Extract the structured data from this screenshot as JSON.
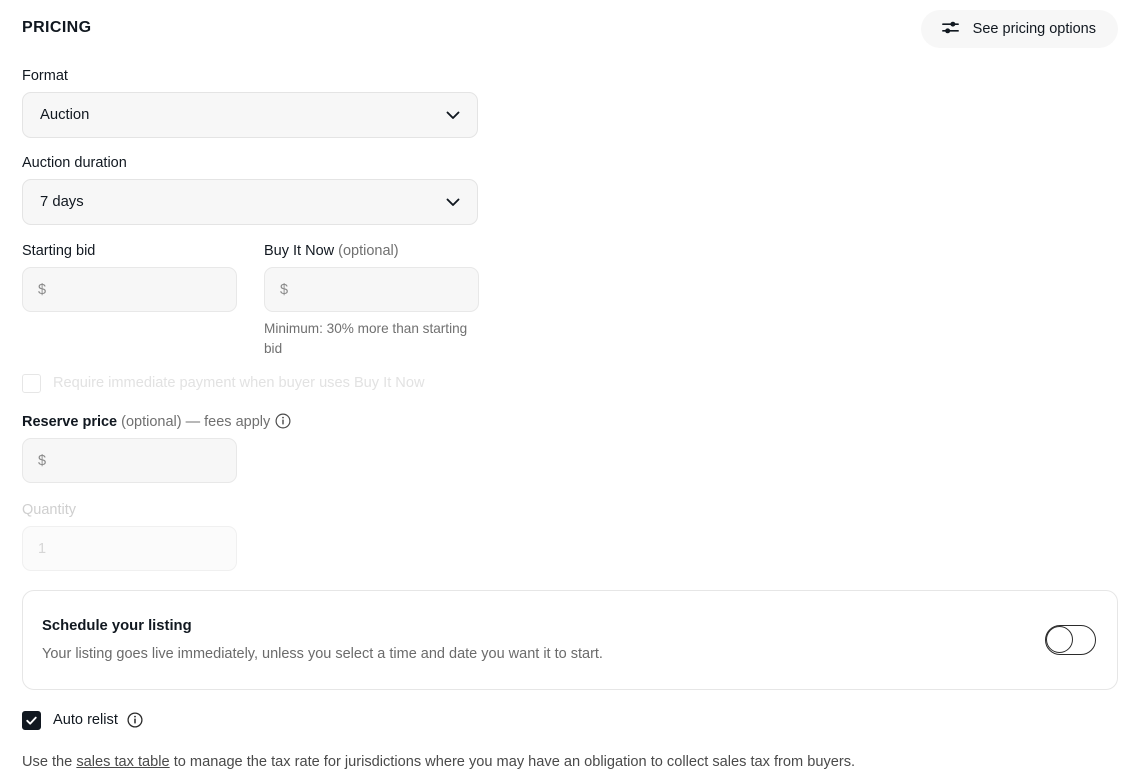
{
  "header": {
    "title": "PRICING",
    "pricing_options_button": "See pricing options",
    "pricing_options_icon": "sliders-icon"
  },
  "format": {
    "label": "Format",
    "value": "Auction",
    "chevron_icon": "chevron-down-icon"
  },
  "auction_duration": {
    "label": "Auction duration",
    "value": "7 days",
    "chevron_icon": "chevron-down-icon"
  },
  "starting_bid": {
    "label": "Starting bid",
    "placeholder": "$",
    "value": ""
  },
  "buy_it_now": {
    "label": "Buy It Now",
    "label_optional": "(optional)",
    "placeholder": "$",
    "value": "",
    "helper": "Minimum: 30% more than starting bid"
  },
  "require_immediate_payment": {
    "label": "Require immediate payment when buyer uses Buy It Now",
    "checked": false,
    "disabled": true
  },
  "reserve_price": {
    "label": "Reserve price",
    "label_suffix": "(optional) — fees apply",
    "info_icon": "info-icon",
    "placeholder": "$",
    "value": ""
  },
  "quantity": {
    "label": "Quantity",
    "value": "1",
    "disabled": true
  },
  "schedule": {
    "title": "Schedule your listing",
    "description": "Your listing goes live immediately, unless you select a time and date you want it to start.",
    "toggle_state": "off",
    "toggle_name": "schedule-listing-toggle"
  },
  "auto_relist": {
    "label": "Auto relist",
    "checked": true,
    "info_icon": "info-icon"
  },
  "tax_note": {
    "prefix": "Use the ",
    "link": "sales tax table",
    "suffix": " to manage the tax rate for jurisdictions where you may have an obligation to collect sales tax from buyers."
  },
  "colors": {
    "text": "#111820",
    "muted": "#707070",
    "field_bg": "#f7f7f7",
    "border": "#e6e6e6",
    "accent": "#111820"
  }
}
